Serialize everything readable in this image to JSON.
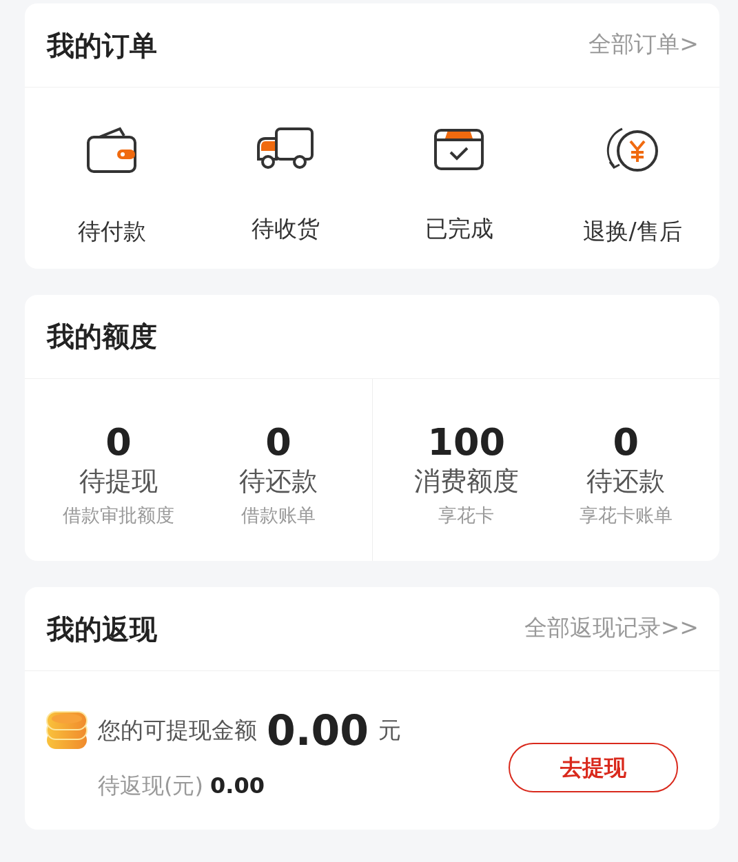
{
  "orders": {
    "title": "我的订单",
    "link": "全部订单>",
    "items": [
      {
        "label": "待付款"
      },
      {
        "label": "待收货"
      },
      {
        "label": "已完成"
      },
      {
        "label": "退换/售后"
      }
    ]
  },
  "quota": {
    "title": "我的额度",
    "stats": [
      {
        "value": "0",
        "label": "待提现",
        "sub": "借款审批额度"
      },
      {
        "value": "0",
        "label": "待还款",
        "sub": "借款账单"
      },
      {
        "value": "100",
        "label": "消费额度",
        "sub": "享花卡"
      },
      {
        "value": "0",
        "label": "待还款",
        "sub": "享花卡账单"
      }
    ]
  },
  "cashback": {
    "title": "我的返现",
    "link": "全部返现记录>>",
    "available_label": "您的可提现金额",
    "available_amount": "0.00",
    "unit": "元",
    "pending_label": "待返现(元)",
    "pending_amount": "0.00",
    "button": "去提现"
  }
}
